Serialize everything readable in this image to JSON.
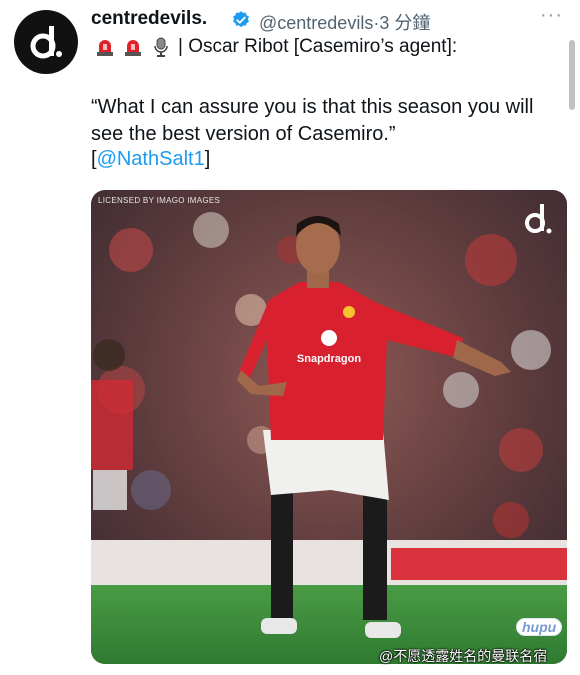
{
  "tweet": {
    "display_name": "centredevils.",
    "handle": "@centredevils",
    "separator": "·",
    "time": "3 分鐘",
    "more": "···",
    "source_prefix": "| Oscar Ribot [Casemiro’s agent]:",
    "quote": "“What I can assure you is that this season you will see the best version of Casemiro.”",
    "mention_open": "[",
    "mention": "@NathSalt1",
    "mention_close": "]"
  },
  "emojis": [
    "siren-icon",
    "siren-icon",
    "microphone-icon"
  ],
  "photo": {
    "credit": "LICENSED BY IMAGO IMAGES",
    "sponsor": "Snapdragon"
  },
  "watermarks": {
    "hupu": "hupu",
    "user": "@不愿透露姓名的曼联名宿"
  },
  "colors": {
    "link": "#1d9bf0",
    "verified": "#1d9bf0",
    "jersey": "#d8202f",
    "pitch": "#3e8f3a"
  }
}
